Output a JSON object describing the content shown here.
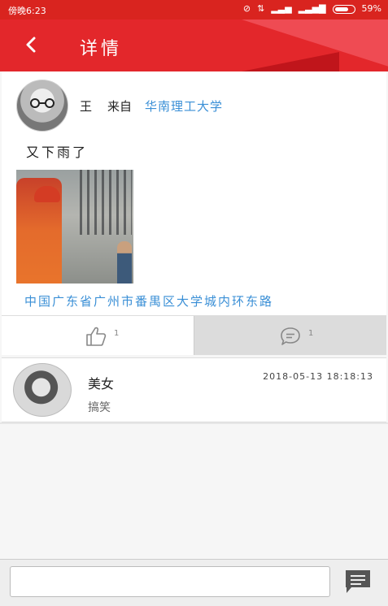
{
  "status_bar": {
    "time": "傍晚6:23",
    "battery": "59%"
  },
  "header": {
    "title": "详情"
  },
  "post": {
    "author": "王",
    "from_label": "来自",
    "school": "华南理工大学",
    "content": "又下雨了",
    "location": "中国广东省广州市番禺区大学城内环东路",
    "like_count": "1",
    "comment_count": "1"
  },
  "comments": [
    {
      "name": "美女",
      "time": "2018-05-13 18:18:13",
      "text": "搞笑"
    }
  ],
  "input": {
    "placeholder": ""
  },
  "colors": {
    "brand": "#e3272b",
    "link": "#3a8fd6"
  }
}
